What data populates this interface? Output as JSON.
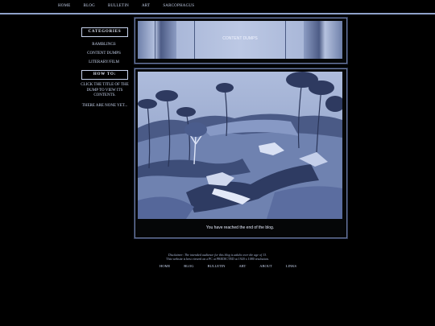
{
  "nav": {
    "items": [
      "HOME",
      "BLOG",
      "BULLETIN",
      "ART",
      "SARCOPHAGUS"
    ]
  },
  "sidebar": {
    "categories_title": "CATEGORIES",
    "categories": [
      "RAMBLINGS",
      "CONTENT DUMPS",
      "LITERARY/FILM"
    ],
    "howto_title": "HOW TO:",
    "howto_text": "CLICK THE TITLE OF THE DUMP TO VIEW ITS CONTENTS.",
    "empty_text": "THERE ARE NONE YET..."
  },
  "banner": {
    "title": "CONTENT DUMPS"
  },
  "main": {
    "end_message": "You have reached the end of the blog."
  },
  "footer": {
    "disclaimer": "Disclaimer: The intended audience for this blog is adults over the age of 13.",
    "viewing_note": "This website is best viewed on a PC at PREDICTED at 1920 x 1080 resolution.",
    "nav": [
      "HOME",
      "BLOG",
      "BULLETIN",
      "ART",
      "ABOUT",
      "LINKS"
    ]
  },
  "colors": {
    "accent": "#8fa2c9",
    "text": "#c8d4ee",
    "background": "#000000"
  }
}
